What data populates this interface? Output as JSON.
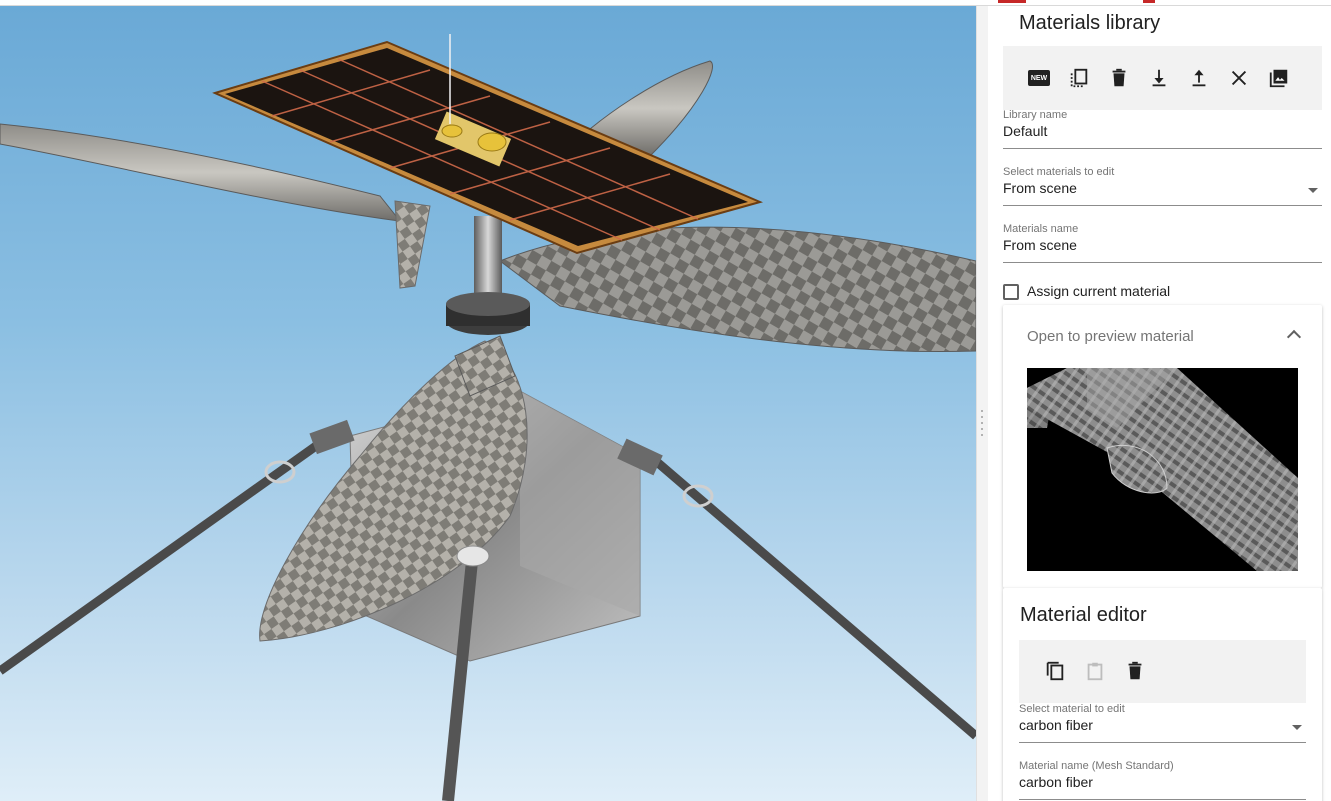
{
  "library": {
    "title": "Materials library",
    "toolbar": {
      "new_badge": "NEW",
      "icons": [
        "new-icon",
        "duplicate-icon",
        "delete-icon",
        "download-icon",
        "upload-icon",
        "close-icon",
        "image-icon"
      ]
    },
    "library_name": {
      "label": "Library name",
      "value": "Default"
    },
    "select_materials": {
      "label": "Select materials to edit",
      "value": "From scene"
    },
    "materials_name": {
      "label": "Materials name",
      "value": "From scene"
    },
    "assign_current": {
      "label": "Assign current material",
      "checked": false
    },
    "preview": {
      "label": "Open to preview material",
      "expanded": true
    }
  },
  "editor": {
    "title": "Material editor",
    "toolbar": {
      "icons": [
        "copy-icon",
        "paste-icon",
        "delete-icon"
      ]
    },
    "select_material": {
      "label": "Select material to edit",
      "value": "carbon fiber"
    },
    "material_name": {
      "label": "Material name (Mesh Standard)",
      "value": "carbon fiber"
    }
  },
  "colors": {
    "accent": "#c62828",
    "sky_top": "#6aa9d6",
    "sky_bottom": "#dfeef8",
    "panel_bg": "#ffffff",
    "toolbar_bg": "#f2f2f2"
  }
}
